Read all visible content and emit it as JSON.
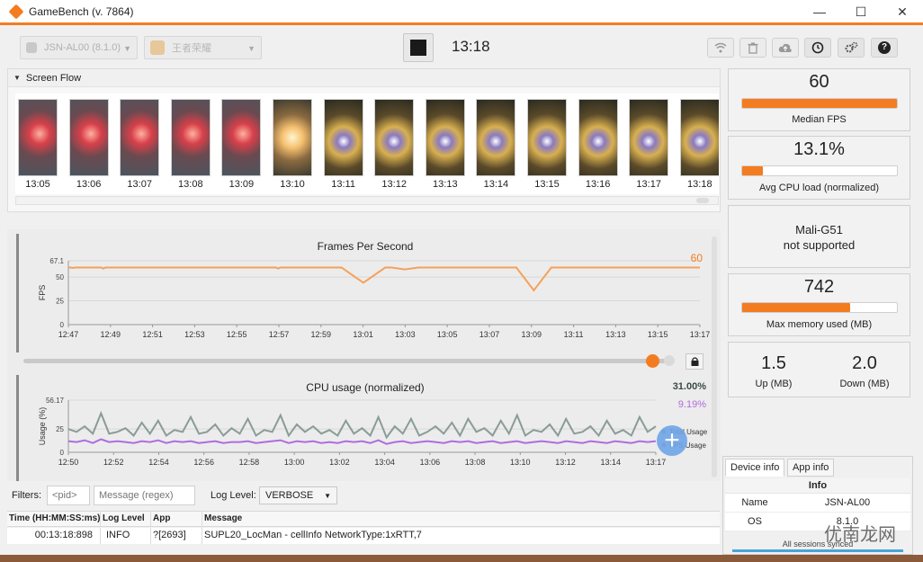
{
  "window": {
    "title": "GameBench (v. 7864)"
  },
  "window_controls": {
    "minimize": "—",
    "maximize": "☐",
    "close": "✕"
  },
  "toolbar": {
    "device": "JSN-AL00 (8.1.0)",
    "app": "王者荣耀",
    "timer": "13:18",
    "icons": [
      "wifi-icon",
      "trash-icon",
      "cloud-upload-icon",
      "clock-icon",
      "settings-icon",
      "help-icon"
    ],
    "help_glyph": "?"
  },
  "screen_flow": {
    "title": "Screen Flow",
    "frames": [
      {
        "time": "13:05",
        "palette": "red"
      },
      {
        "time": "13:06",
        "palette": "red"
      },
      {
        "time": "13:07",
        "palette": "red"
      },
      {
        "time": "13:08",
        "palette": "red"
      },
      {
        "time": "13:09",
        "palette": "red"
      },
      {
        "time": "13:10",
        "palette": "flash"
      },
      {
        "time": "13:11",
        "palette": "gold"
      },
      {
        "time": "13:12",
        "palette": "gold"
      },
      {
        "time": "13:13",
        "palette": "gold"
      },
      {
        "time": "13:14",
        "palette": "gold"
      },
      {
        "time": "13:15",
        "palette": "gold"
      },
      {
        "time": "13:16",
        "palette": "gold"
      },
      {
        "time": "13:17",
        "palette": "gold"
      },
      {
        "time": "13:18",
        "palette": "gold"
      }
    ]
  },
  "chart_data": [
    {
      "type": "line",
      "title": "Frames Per Second",
      "ylabel": "FPS",
      "ylim": [
        0,
        67.1
      ],
      "yticks": [
        "67.1",
        "50",
        "25",
        "0"
      ],
      "ytick_values": [
        67.1,
        50,
        25,
        0
      ],
      "xticks": [
        "12:47",
        "12:49",
        "12:51",
        "12:53",
        "12:55",
        "12:57",
        "12:59",
        "13:01",
        "13:03",
        "13:05",
        "13:07",
        "13:09",
        "13:11",
        "13:13",
        "13:15",
        "13:17"
      ],
      "current_label": "60",
      "color": "#f5a15a",
      "series": [
        {
          "values": [
            60,
            60,
            59.5,
            60,
            60,
            60,
            60,
            60,
            60,
            60,
            60,
            60,
            60,
            60,
            60,
            60,
            59,
            60,
            60,
            60,
            60,
            60,
            60,
            60,
            60,
            60,
            60,
            60,
            60,
            60,
            60,
            60,
            60,
            60,
            60,
            60,
            60,
            60,
            60,
            60,
            60,
            60,
            60,
            60,
            60,
            60,
            60,
            60,
            60,
            60,
            60,
            60,
            60,
            60,
            60,
            60,
            60,
            60,
            60,
            60,
            60,
            60,
            60,
            60,
            60,
            60,
            60,
            60,
            60,
            60,
            60,
            60,
            60,
            60,
            60,
            60,
            60,
            60,
            60,
            60,
            60,
            60,
            60,
            60,
            60,
            60,
            60,
            60,
            60,
            60,
            60,
            60,
            60,
            60,
            60,
            60,
            59,
            60,
            60,
            60,
            60,
            60,
            60,
            60,
            60,
            60,
            60,
            60,
            60,
            60,
            60,
            60,
            60,
            60,
            60,
            60,
            60,
            60,
            60,
            60,
            60,
            60,
            60,
            60,
            60,
            60,
            60,
            60,
            60,
            60,
            60,
            60,
            60,
            60,
            60,
            60,
            60,
            60,
            60,
            60,
            60,
            60,
            60,
            60,
            60,
            60,
            60,
            60,
            60,
            60,
            60,
            60,
            60,
            60,
            60,
            60,
            60,
            60,
            60,
            60,
            60,
            60,
            60,
            60,
            60,
            60,
            60,
            60,
            60,
            60,
            60,
            60,
            60,
            60,
            60,
            60,
            60,
            60,
            60,
            60,
            60,
            60,
            60,
            60,
            60,
            60,
            60,
            60,
            60,
            60,
            60,
            60,
            60,
            60,
            60,
            60,
            60,
            60,
            60,
            60,
            60,
            60,
            60,
            60,
            60,
            60,
            60,
            60,
            60,
            60,
            60,
            60,
            60,
            60,
            60,
            60,
            60,
            60,
            60,
            60,
            60,
            60,
            60,
            60,
            60,
            60,
            60,
            60,
            60,
            60,
            60,
            60,
            60,
            60,
            60,
            60,
            60,
            60,
            60,
            60,
            60,
            60,
            60,
            60,
            60,
            60,
            60,
            60,
            60,
            60,
            60,
            60,
            60,
            60,
            60,
            60,
            60,
            60,
            60,
            60,
            60,
            60,
            60,
            60,
            60,
            60,
            60,
            60,
            60,
            60,
            60,
            60,
            60,
            60,
            60,
            60,
            60,
            60,
            60,
            60,
            60,
            60,
            60,
            60,
            60,
            60,
            60,
            60,
            60,
            60
          ]
        }
      ]
    },
    {
      "type": "line",
      "title": "CPU usage (normalized)",
      "ylabel": "Usage (%)",
      "ylim": [
        0,
        56.17
      ],
      "yticks": [
        "56.17",
        "25",
        "0"
      ],
      "ytick_values": [
        56.17,
        25,
        0
      ],
      "xticks": [
        "12:50",
        "12:52",
        "12:54",
        "12:56",
        "12:58",
        "13:00",
        "13:02",
        "13:04",
        "13:06",
        "13:08",
        "13:10",
        "13:12",
        "13:14",
        "13:17"
      ],
      "series": [
        {
          "name": "Total Usage",
          "color": "#8a9c98",
          "current": "31.00%",
          "values": [
            25,
            22,
            28,
            20,
            42,
            20,
            22,
            26,
            18,
            32,
            20,
            34,
            18,
            24,
            22,
            38,
            20,
            22,
            30,
            18,
            26,
            20,
            36,
            18,
            24,
            22,
            40,
            18,
            30,
            22,
            28,
            20,
            24,
            18,
            34,
            20,
            26,
            18,
            38,
            16,
            28,
            20,
            36,
            18,
            22,
            28,
            20,
            32,
            18,
            36,
            22,
            26,
            18,
            34,
            20,
            40,
            18,
            24,
            22,
            30,
            18,
            36,
            20,
            22,
            28,
            18,
            34,
            20,
            24,
            18,
            38,
            22,
            28
          ]
        },
        {
          "name": "FPS Usage",
          "color": "#b06ce0",
          "current": "9.19%",
          "values": [
            12,
            11,
            13,
            10,
            14,
            11,
            12,
            11,
            10,
            12,
            11,
            13,
            10,
            12,
            11,
            12,
            10,
            11,
            12,
            10,
            11,
            11,
            12,
            10,
            11,
            12,
            13,
            10,
            12,
            11,
            12,
            10,
            11,
            10,
            12,
            11,
            12,
            10,
            13,
            9,
            11,
            12,
            10,
            11,
            12,
            11,
            10,
            12,
            11,
            12,
            10,
            11,
            12,
            10,
            11,
            12,
            10,
            11,
            12,
            11,
            10,
            12,
            11,
            10,
            12,
            11,
            10,
            12,
            11,
            10,
            12,
            11,
            12
          ]
        }
      ]
    }
  ],
  "metrics": {
    "fps": {
      "value": "60",
      "label": "Median FPS",
      "fill": 1.0
    },
    "cpu": {
      "value": "13.1%",
      "label": "Avg CPU load (normalized)",
      "fill": 0.131
    },
    "gpu": {
      "line1": "Mali-G51",
      "line2": "not supported"
    },
    "memory": {
      "value": "742",
      "label": "Max memory used (MB)",
      "fill": 0.7
    },
    "network": {
      "up_value": "1.5",
      "up_label": "Up (MB)",
      "down_value": "2.0",
      "down_label": "Down (MB)"
    }
  },
  "info_panel": {
    "tabs": [
      "Device info",
      "App info"
    ],
    "header": "Info",
    "rows": [
      {
        "key": "Name",
        "value": "JSN-AL00"
      },
      {
        "key": "OS",
        "value": "8.1.0"
      }
    ],
    "sync_status": "All sessions synced"
  },
  "log": {
    "filters_label": "Filters:",
    "pid_placeholder": "<pid>",
    "message_placeholder": "Message (regex)",
    "loglevel_label": "Log Level:",
    "loglevel_value": "VERBOSE",
    "columns": [
      "Time (HH:MM:SS:ms)",
      "Log Level",
      "App",
      "Message"
    ],
    "rows": [
      {
        "time": "00:13:18:898",
        "level": "INFO",
        "app": "?[2693]",
        "message": "SUPL20_LocMan - cellInfo NetworkType:1xRTT,7"
      }
    ]
  },
  "watermark": "优南龙网",
  "colors": {
    "accent": "#f47c20",
    "fps_line": "#f5a15a",
    "cpu_total": "#8a9c98",
    "cpu_fps": "#b06ce0"
  }
}
